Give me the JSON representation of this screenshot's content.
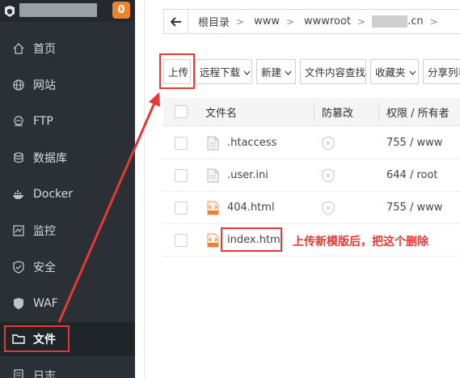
{
  "sidebar": {
    "badge": "0",
    "items": [
      {
        "label": "首页",
        "icon": "home-icon"
      },
      {
        "label": "网站",
        "icon": "globe-icon"
      },
      {
        "label": "FTP",
        "icon": "ftp-icon"
      },
      {
        "label": "数据库",
        "icon": "database-icon"
      },
      {
        "label": "Docker",
        "icon": "docker-icon"
      },
      {
        "label": "监控",
        "icon": "monitor-icon"
      },
      {
        "label": "安全",
        "icon": "shield-icon"
      },
      {
        "label": "WAF",
        "icon": "waf-icon"
      },
      {
        "label": "文件",
        "icon": "folder-icon",
        "active": true
      },
      {
        "label": "日志",
        "icon": "log-icon"
      }
    ]
  },
  "path": {
    "crumbs": [
      "根目录",
      "www",
      "wwwroot",
      ".cn"
    ]
  },
  "toolbar": {
    "upload": "上传",
    "remote_download": "远程下载",
    "new": "新建",
    "content_search": "文件内容查找",
    "favorites": "收藏夹",
    "share_list": "分享列表"
  },
  "table": {
    "headers": {
      "name": "文件名",
      "tamper": "防篡改",
      "perm": "权限 / 所有者"
    },
    "rows": [
      {
        "name": ".htaccess",
        "type": "file",
        "perm": "755 / www"
      },
      {
        "name": ".user.ini",
        "type": "file",
        "perm": "644 / root"
      },
      {
        "name": "404.html",
        "type": "html",
        "perm": "755 / www"
      },
      {
        "name": "index.html",
        "type": "html",
        "perm": ""
      }
    ]
  },
  "annotation": {
    "text": "上传新模版后，把这个删除",
    "color": "#e53935"
  },
  "colors": {
    "sidebar_bg": "#2b3036",
    "badge": "#f0822b",
    "annotation_red": "#e53935"
  }
}
